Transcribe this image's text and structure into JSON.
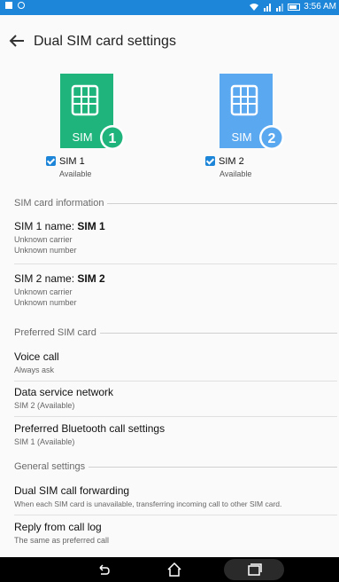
{
  "status_bar": {
    "time": "3:56 AM"
  },
  "header": {
    "title": "Dual SIM card settings"
  },
  "sims": [
    {
      "badge": "SIM",
      "number": "1",
      "label": "SIM 1",
      "status": "Available",
      "color": "#1fb47c"
    },
    {
      "badge": "SIM",
      "number": "2",
      "label": "SIM 2",
      "status": "Available",
      "color": "#5aa8f0"
    }
  ],
  "sections": {
    "sim_info": "SIM card information",
    "preferred": "Preferred SIM card",
    "general": "General settings"
  },
  "sim_info": [
    {
      "name_prefix": "SIM 1 name: ",
      "name": "SIM 1",
      "carrier": "Unknown carrier",
      "number": "Unknown number"
    },
    {
      "name_prefix": "SIM 2 name: ",
      "name": "SIM 2",
      "carrier": "Unknown carrier",
      "number": "Unknown number"
    }
  ],
  "preferred": [
    {
      "title": "Voice call",
      "sub": "Always ask"
    },
    {
      "title": "Data service network",
      "sub": "SIM 2 (Available)"
    },
    {
      "title": "Preferred Bluetooth call settings",
      "sub": "SIM 1 (Available)"
    }
  ],
  "general": [
    {
      "title": "Dual SIM call forwarding",
      "sub": "When each SIM card is unavailable, transferring incoming call to other SIM card."
    },
    {
      "title": "Reply from call log",
      "sub": "The same as preferred call"
    }
  ],
  "colors": {
    "accent": "#1e86d8",
    "sim1": "#1fb47c",
    "sim2": "#5aa8f0"
  }
}
